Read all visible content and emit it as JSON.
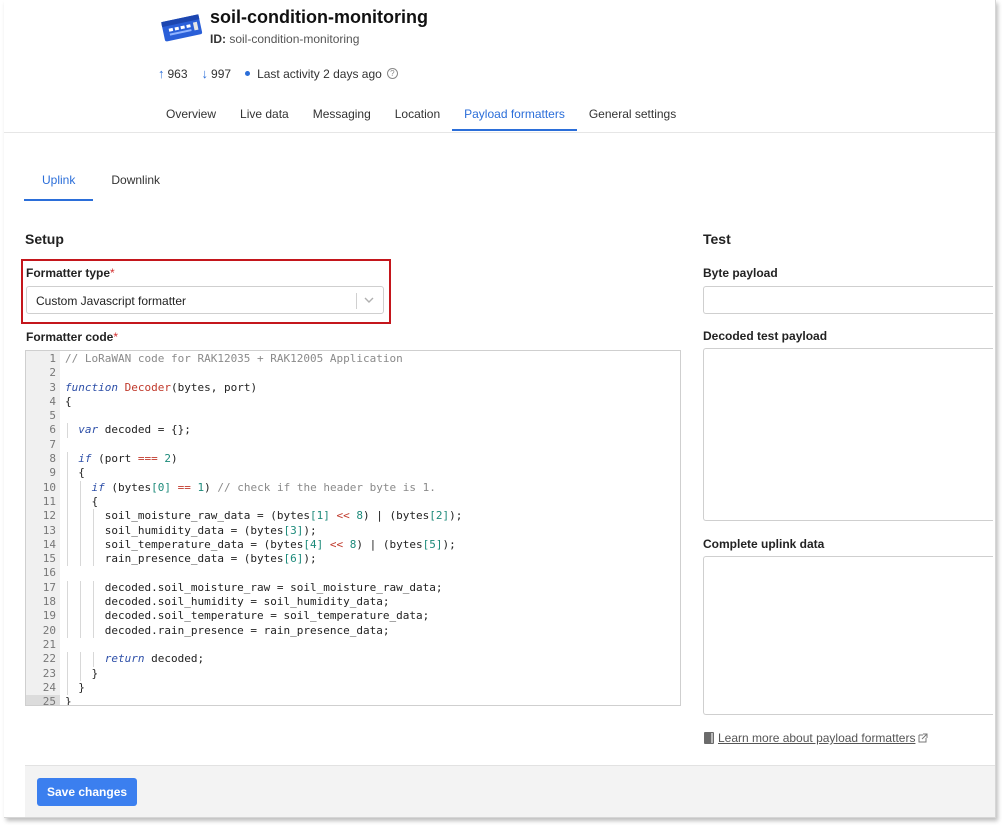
{
  "header": {
    "title": "soil-condition-monitoring",
    "id_label": "ID:",
    "id_value": "soil-condition-monitoring",
    "uplink_count": "963",
    "downlink_count": "997",
    "last_activity": "Last activity 2 days ago",
    "icons": {
      "device": "device-board-icon",
      "uplink": "arrow-up-icon",
      "downlink": "arrow-down-icon",
      "help": "help-icon"
    }
  },
  "tabs": [
    {
      "label": "Overview"
    },
    {
      "label": "Live data"
    },
    {
      "label": "Messaging"
    },
    {
      "label": "Location"
    },
    {
      "label": "Payload formatters"
    },
    {
      "label": "General settings"
    }
  ],
  "active_tab": "Payload formatters",
  "subtabs": [
    {
      "label": "Uplink"
    },
    {
      "label": "Downlink"
    }
  ],
  "setup": {
    "title": "Setup",
    "formatter_type_label": "Formatter type",
    "formatter_type_value": "Custom Javascript formatter",
    "formatter_code_label": "Formatter code",
    "required_mark": "*"
  },
  "code_lines": [
    "// LoRaWAN code for RAK12035 + RAK12005 Application",
    "",
    "function Decoder(bytes, port)",
    "{",
    "",
    "  var decoded = {};",
    "",
    "  if (port === 2)",
    "  {",
    "    if (bytes[0] == 1) // check if the header byte is 1.",
    "    {",
    "      soil_moisture_raw_data = (bytes[1] << 8) | (bytes[2]);",
    "      soil_humidity_data = (bytes[3]);",
    "      soil_temperature_data = (bytes[4] << 8) | (bytes[5]);",
    "      rain_presence_data = (bytes[6]);",
    "",
    "      decoded.soil_moisture_raw = soil_moisture_raw_data;",
    "      decoded.soil_humidity = soil_humidity_data;",
    "      decoded.soil_temperature = soil_temperature_data;",
    "      decoded.rain_presence = rain_presence_data;",
    "",
    "      return decoded;",
    "    }",
    "  }",
    "}"
  ],
  "test": {
    "title": "Test",
    "byte_payload_label": "Byte payload",
    "decoded_label": "Decoded test payload",
    "complete_label": "Complete uplink data",
    "learn_more": "Learn more about payload formatters"
  },
  "footer": {
    "save_label": "Save changes"
  },
  "colors": {
    "accent": "#2b6ed9",
    "button": "#3b7fef",
    "highlight": "#c4161c",
    "required": "#d32f2f"
  }
}
